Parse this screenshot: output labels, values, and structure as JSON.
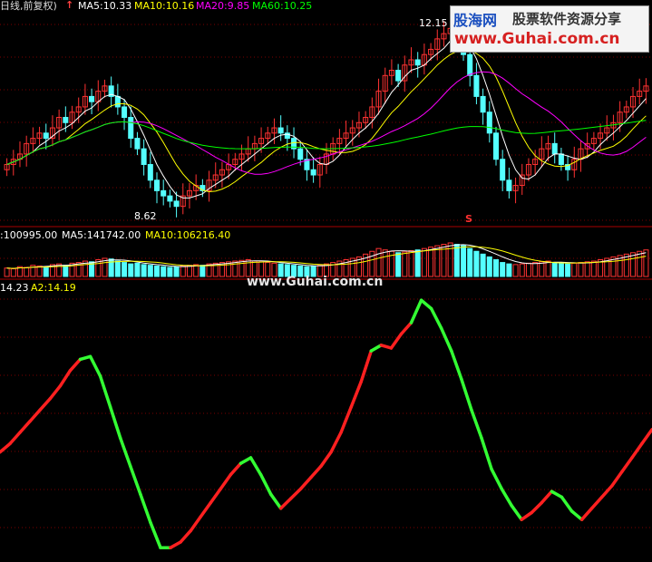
{
  "header": {
    "period_label": "日线,前复权)",
    "ma5_label": "MA5:10.33",
    "ma10_label": "MA10:10.16",
    "ma20_label": "MA20:9.85",
    "ma60_label": "MA60:10.25",
    "high_marker": "12.15",
    "low_marker": "8.62",
    "s_marker": "S"
  },
  "volume": {
    "vol_label": ":100995.00",
    "ma5_label": "MA5:141742.00",
    "ma10_label": "MA10:106216.40"
  },
  "indicator": {
    "a1_label": "14.23",
    "a2_label": "A2:14.19"
  },
  "watermark": {
    "logo_name": "股海网",
    "logo_cn": "股票软件资源分享",
    "logo_url": "www.Guhai.com.cn",
    "mid_url": "www.Guhai.com.cn"
  },
  "colors": {
    "up": "#ff3232",
    "down": "#54ffff",
    "ma5": "#ffffff",
    "ma10": "#ffff00",
    "ma20": "#ff00ff",
    "ma60": "#00ff00",
    "indicator_up": "#ff2020",
    "indicator_down": "#33ff33"
  },
  "chart_data": {
    "type": "line",
    "candle_closes": [
      9.5,
      9.6,
      9.7,
      9.9,
      10.0,
      10.1,
      10.0,
      10.2,
      10.4,
      10.3,
      10.5,
      10.6,
      10.8,
      10.7,
      10.9,
      11.0,
      10.8,
      10.6,
      10.4,
      10.0,
      9.8,
      9.5,
      9.2,
      9.0,
      8.9,
      8.8,
      8.7,
      8.9,
      9.0,
      9.1,
      9.0,
      9.2,
      9.3,
      9.4,
      9.5,
      9.6,
      9.7,
      9.8,
      9.9,
      10.0,
      10.1,
      10.2,
      10.1,
      10.0,
      9.8,
      9.6,
      9.4,
      9.3,
      9.5,
      9.7,
      9.9,
      10.0,
      10.1,
      10.2,
      10.3,
      10.4,
      10.6,
      10.9,
      11.2,
      11.3,
      11.1,
      11.4,
      11.5,
      11.4,
      11.6,
      11.7,
      11.9,
      12.0,
      12.1,
      11.9,
      11.6,
      11.2,
      10.8,
      10.5,
      10.1,
      9.6,
      9.2,
      9.0,
      9.1,
      9.3,
      9.5,
      9.6,
      9.8,
      9.9,
      9.7,
      9.5,
      9.4,
      9.6,
      9.8,
      9.9,
      10.0,
      10.1,
      10.2,
      10.3,
      10.5,
      10.6,
      10.8,
      10.9,
      11.0
    ],
    "volume_values": [
      60,
      55,
      70,
      65,
      80,
      75,
      70,
      85,
      90,
      80,
      95,
      100,
      110,
      105,
      120,
      130,
      125,
      110,
      100,
      90,
      95,
      85,
      80,
      75,
      70,
      65,
      70,
      75,
      80,
      85,
      80,
      90,
      95,
      100,
      105,
      110,
      115,
      120,
      110,
      105,
      100,
      95,
      90,
      85,
      80,
      75,
      70,
      75,
      80,
      90,
      100,
      110,
      120,
      130,
      140,
      160,
      180,
      200,
      190,
      180,
      170,
      175,
      185,
      190,
      200,
      210,
      220,
      230,
      240,
      230,
      220,
      200,
      180,
      160,
      140,
      120,
      100,
      90,
      85,
      90,
      95,
      100,
      105,
      110,
      100,
      95,
      90,
      95,
      100,
      105,
      110,
      120,
      130,
      140,
      150,
      160,
      170,
      180,
      190
    ],
    "indicator_values": [
      8,
      14,
      22,
      30,
      38,
      46,
      55,
      66,
      74,
      76,
      62,
      40,
      18,
      -2,
      -22,
      -42,
      -60,
      -60,
      -56,
      -48,
      -38,
      -28,
      -18,
      -8,
      0,
      4,
      -8,
      -22,
      -32,
      -25,
      -18,
      -10,
      -2,
      8,
      22,
      40,
      58,
      80,
      84,
      82,
      92,
      100,
      116,
      110,
      96,
      80,
      60,
      38,
      18,
      -4,
      -18,
      -30,
      -40,
      -35,
      -28,
      -20,
      -24,
      -34,
      -40,
      -32,
      -24,
      -16,
      -6,
      4,
      14,
      24
    ],
    "indicator_up_flags": [
      1,
      1,
      1,
      1,
      1,
      1,
      1,
      1,
      1,
      0,
      0,
      0,
      0,
      0,
      0,
      0,
      0,
      0,
      1,
      1,
      1,
      1,
      1,
      1,
      1,
      0,
      0,
      0,
      0,
      1,
      1,
      1,
      1,
      1,
      1,
      1,
      1,
      1,
      0,
      1,
      1,
      1,
      0,
      0,
      0,
      0,
      0,
      0,
      0,
      0,
      0,
      0,
      0,
      1,
      1,
      1,
      0,
      0,
      0,
      1,
      1,
      1,
      1,
      1,
      1,
      1
    ],
    "price_ylim": [
      8.4,
      12.4
    ],
    "indicator_ylim": [
      -65,
      120
    ]
  }
}
